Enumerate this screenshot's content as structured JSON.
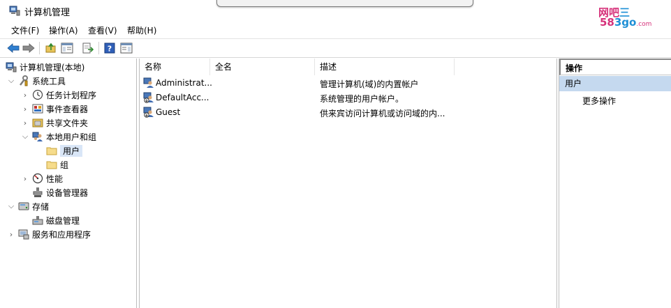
{
  "window": {
    "title": "计算机管理"
  },
  "menubar": {
    "items": [
      "文件(F)",
      "操作(A)",
      "查看(V)",
      "帮助(H)"
    ]
  },
  "toolbar": {
    "icons": [
      "back-arrow-icon",
      "forward-arrow-icon",
      "up-folder-icon",
      "show-hide-console-tree-icon",
      "export-list-icon",
      "help-icon",
      "show-hide-action-pane-icon"
    ]
  },
  "watermark": {
    "line1_a": "网吧",
    "line1_b": "三",
    "line2_a": "58",
    "line2_b": "3go",
    "line2_c": ".com"
  },
  "tree": {
    "items": [
      {
        "label": "计算机管理(本地)",
        "icon": "computer-management-icon"
      },
      {
        "label": "系统工具",
        "icon": "system-tools-icon"
      },
      {
        "label": "任务计划程序",
        "icon": "clock-icon"
      },
      {
        "label": "事件查看器",
        "icon": "event-viewer-icon"
      },
      {
        "label": "共享文件夹",
        "icon": "shared-folder-icon"
      },
      {
        "label": "本地用户和组",
        "icon": "users-group-icon"
      },
      {
        "label": "用户",
        "icon": "folder-icon"
      },
      {
        "label": "组",
        "icon": "folder-icon"
      },
      {
        "label": "性能",
        "icon": "performance-icon"
      },
      {
        "label": "设备管理器",
        "icon": "device-manager-icon"
      },
      {
        "label": "存储",
        "icon": "storage-icon"
      },
      {
        "label": "磁盘管理",
        "icon": "disk-management-icon"
      },
      {
        "label": "服务和应用程序",
        "icon": "services-apps-icon"
      }
    ]
  },
  "list": {
    "columns": [
      "名称",
      "全名",
      "描述"
    ],
    "rows": [
      {
        "name": "Administrat...",
        "fullname": "",
        "description": "管理计算机(域)的内置帐户"
      },
      {
        "name": "DefaultAcc...",
        "fullname": "",
        "description": "系统管理的用户帐户。"
      },
      {
        "name": "Guest",
        "fullname": "",
        "description": "供来宾访问计算机或访问域的内..."
      }
    ]
  },
  "actions": {
    "title": "操作",
    "section": "用户",
    "more": "更多操作"
  },
  "colors": {
    "selection": "#d9e6f7",
    "action_section": "#c5d9ef",
    "watermark_pink": "#d6317a",
    "watermark_blue": "#1d8fd6"
  }
}
